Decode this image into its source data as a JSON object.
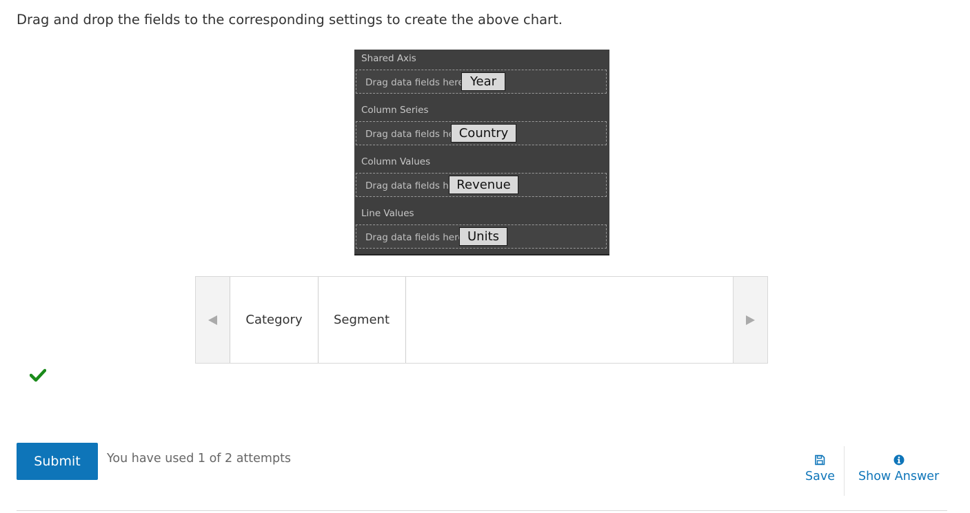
{
  "instruction": "Drag and drop the fields to the corresponding settings to create the above chart.",
  "panel": {
    "drop_hint": "Drag data fields here",
    "sections": [
      {
        "title": "Shared Axis",
        "field": "Year"
      },
      {
        "title": "Column Series",
        "field": "Country"
      },
      {
        "title": "Column Values",
        "field": "Revenue"
      },
      {
        "title": "Line Values",
        "field": "Units"
      }
    ]
  },
  "carousel": {
    "items": [
      "Category",
      "Segment"
    ],
    "prev_icon": "triangle-left-icon",
    "next_icon": "triangle-right-icon"
  },
  "status": {
    "icon": "checkmark-icon",
    "color": "#1a8a1a"
  },
  "footer": {
    "submit_label": "Submit",
    "attempts_text": "You have used 1 of 2 attempts",
    "save_label": "Save",
    "show_answer_label": "Show Answer",
    "accent_color": "#0e75b9"
  }
}
